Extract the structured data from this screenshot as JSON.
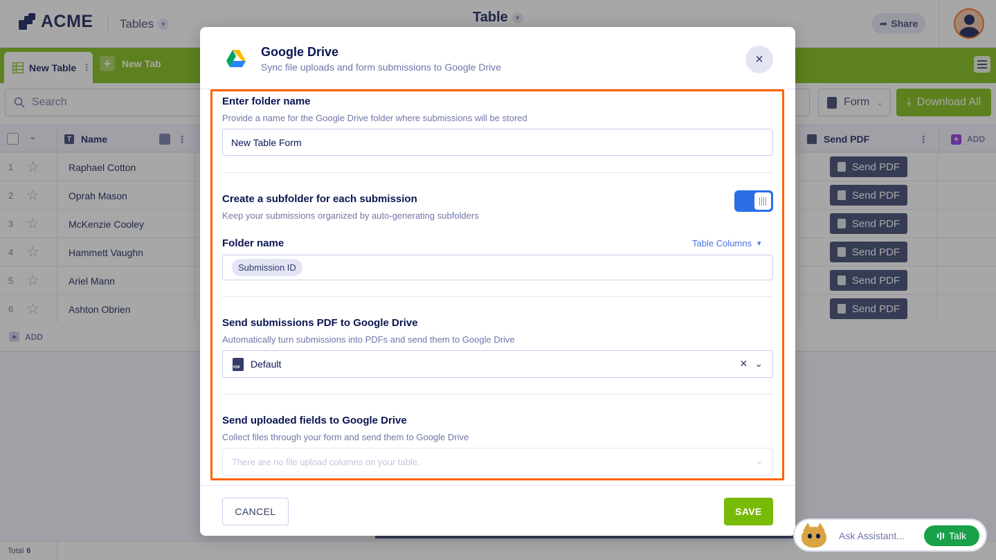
{
  "app": {
    "logo_text": "ACME",
    "workspace_dropdown": "Tables",
    "page_title": "Table",
    "share_label": "Share"
  },
  "tabs": {
    "active_label": "New Table",
    "new_tab_label": "New Tab"
  },
  "toolbar": {
    "search_placeholder": "Search",
    "form_label": "Form",
    "download_label": "Download All"
  },
  "grid": {
    "columns": {
      "name": "Name",
      "send_pdf": "Send PDF",
      "add": "ADD"
    },
    "rows": [
      {
        "num": "1",
        "name": "Raphael Cotton",
        "action": "Send PDF"
      },
      {
        "num": "2",
        "name": "Oprah Mason",
        "action": "Send PDF"
      },
      {
        "num": "3",
        "name": "McKenzie Cooley",
        "action": "Send PDF"
      },
      {
        "num": "4",
        "name": "Hammett Vaughn",
        "action": "Send PDF"
      },
      {
        "num": "5",
        "name": "Ariel Mann",
        "action": "Send PDF"
      },
      {
        "num": "6",
        "name": "Ashton Obrien",
        "action": "Send PDF"
      }
    ],
    "add_row_label": "ADD"
  },
  "footer": {
    "total_label": "Total",
    "total_count": "6"
  },
  "assistant": {
    "placeholder": "Ask Assistant...",
    "talk_label": "Talk"
  },
  "modal": {
    "title": "Google Drive",
    "subtitle": "Sync file uploads and form submissions to Google Drive",
    "close_symbol": "×",
    "sections": {
      "folder": {
        "title": "Enter folder name",
        "description": "Provide a name for the Google Drive folder where submissions will be stored",
        "value": "New Table Form"
      },
      "subfolder": {
        "title": "Create a subfolder for each submission",
        "description": "Keep your submissions organized by auto-generating subfolders",
        "enabled": true,
        "folder_name_label": "Folder name",
        "table_columns_label": "Table Columns",
        "chip": "Submission ID"
      },
      "pdf": {
        "title": "Send submissions PDF to Google Drive",
        "description": "Automatically turn submissions into PDFs and send them to Google Drive",
        "selected": "Default",
        "icon_text": "PDF"
      },
      "uploads": {
        "title": "Send uploaded fields to Google Drive",
        "description": "Collect files through your form and send them to Google Drive",
        "placeholder": "There are no file upload columns on your table."
      }
    },
    "cancel_label": "CANCEL",
    "save_label": "SAVE"
  },
  "colors": {
    "accent_green": "#78bb07",
    "highlight_orange": "#ff6100",
    "toggle_blue": "#2b6ee8",
    "navy": "#0a1551"
  }
}
